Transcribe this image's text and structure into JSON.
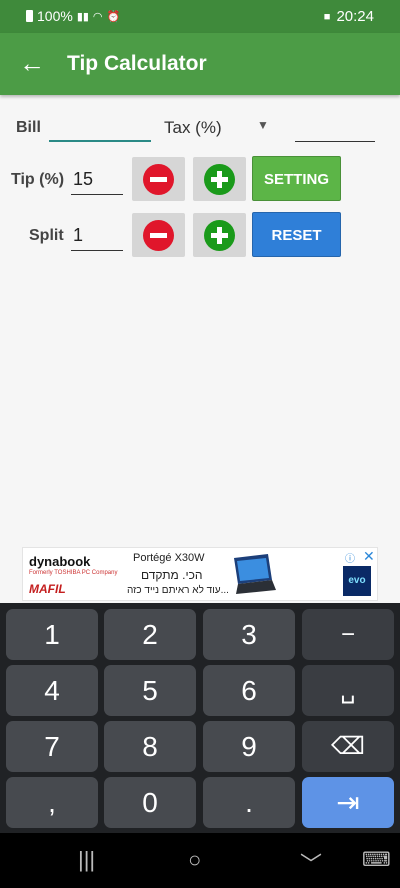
{
  "status_bar": {
    "battery": "100%",
    "signal_icon": "signal-icon",
    "wifi_icon": "wifi-icon",
    "alarm_icon": "alarm-icon",
    "message_icon": "message-icon",
    "time": "20:24"
  },
  "app_bar": {
    "back_icon": "arrow-left-icon",
    "back_glyph": "←",
    "title": "Tip Calculator"
  },
  "form": {
    "bill_label": "Bill",
    "bill_value": "",
    "tax_selected": "Tax (%)",
    "tax_value": "",
    "tip_label": "Tip (%)",
    "tip_value": "15",
    "split_label": "Split",
    "split_value": "1",
    "setting_label": "SETTING",
    "reset_label": "RESET"
  },
  "ad": {
    "brand": "dynabook",
    "brand_sub": "Formerly TOSHIBA PC Company",
    "retailer": "MAFIL",
    "model": "Portégé X30W",
    "headline": "הכי. מתקדם",
    "tagline": "עוד לא ראיתם נייד כזה...",
    "badge": "evo",
    "info_icon": "info-icon",
    "close_icon": "close-icon"
  },
  "keyboard": {
    "row1": [
      "1",
      "2",
      "3",
      "−"
    ],
    "row2": [
      "4",
      "5",
      "6",
      "␣"
    ],
    "row3": [
      "7",
      "8",
      "9",
      "⌫"
    ],
    "row4": [
      ",",
      "0",
      ".",
      "⇥"
    ]
  },
  "nav_bar": {
    "recents": "|||",
    "home": "○",
    "back": "﹀",
    "keyboard": "⌨"
  },
  "colors": {
    "status": "#3f8a3b",
    "appbar": "#4c9c46",
    "setting": "#5cb547",
    "reset": "#2f7fd8",
    "minus": "#e0162b",
    "plus": "#1a9a1a"
  }
}
